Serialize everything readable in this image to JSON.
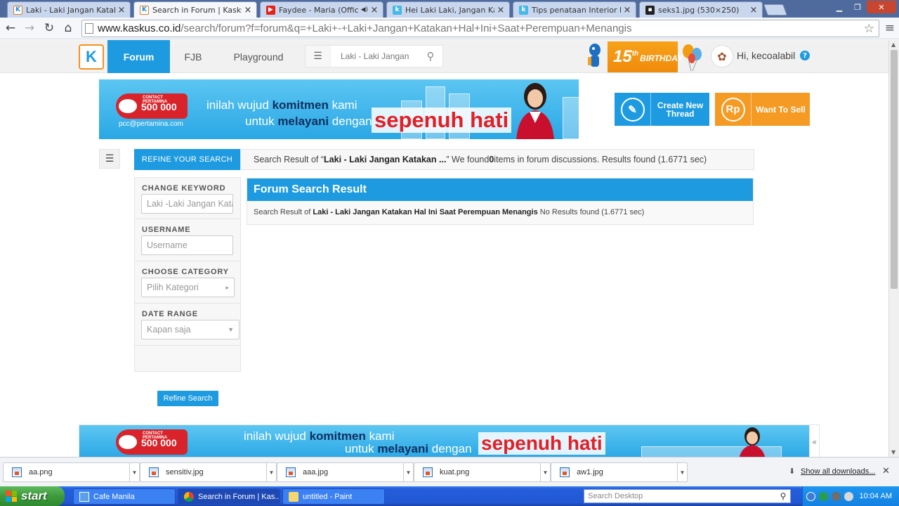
{
  "browser": {
    "tabs": [
      {
        "label": "Laki - Laki Jangan Katakan H",
        "favicon": "kaskus-icon",
        "active": false
      },
      {
        "label": "Search in Forum | Kaskus - Th",
        "favicon": "kaskus-icon",
        "active": true
      },
      {
        "label": "Faydee - Maria (Official V",
        "favicon": "youtube-icon",
        "active": false,
        "audio": true
      },
      {
        "label": "Hei Laki Laki, Jangan Katakan",
        "favicon": "kaskus-k-icon",
        "active": false
      },
      {
        "label": "Tips penataan Interior Ruang",
        "favicon": "kaskus-k-icon",
        "active": false
      },
      {
        "label": "seks1.jpg (530×250)",
        "favicon": "image-icon",
        "active": false
      }
    ],
    "url_host": "www.kaskus.co.id",
    "url_path": "/search/forum?f=forum&q=+Laki+-+Laki+Jangan+Katakan+Hal+Ini+Saat+Perempuan+Menangis"
  },
  "kaskus": {
    "logo": "K",
    "nav": [
      {
        "label": "Forum",
        "active": true
      },
      {
        "label": "FJB",
        "active": false
      },
      {
        "label": "Playground",
        "active": false
      }
    ],
    "search_value": "Laki - Laki Jangan",
    "birthday_num": "15",
    "birthday_sup": "th",
    "birthday_word": "BIRTHDAY",
    "greeting": "Hi, kecoalabil",
    "help": "?"
  },
  "banner": {
    "contact_title": "CONTACT PERTAMINA",
    "contact_number": "500 000",
    "email": "pcc@pertamina.com",
    "line1_pre": "inilah wujud ",
    "line1_bold": "komitmen",
    "line1_post": " kami",
    "line2_pre": "untuk ",
    "line2_bold": "melayani",
    "line2_post": " dengan",
    "big": "sepenuh hati"
  },
  "actions": {
    "create_thread": "Create New Thread",
    "want_to_sell": "Want To Sell",
    "rp_symbol": "Rp"
  },
  "refine": {
    "tab_label": "REFINE YOUR SEARCH",
    "summary_pre": "Search Result of “",
    "summary_query": "Laki - Laki Jangan Katakan ...",
    "summary_mid": "” We found ",
    "summary_count": "0",
    "summary_post": " items in forum discussions. Results found (1.6771 sec)",
    "change_keyword_label": "CHANGE KEYWORD",
    "keyword_value": "Laki -Laki Jangan Kata",
    "username_label": "USERNAME",
    "username_placeholder": "Username",
    "category_label": "CHOOSE CATEGORY",
    "category_value": "Pilih Kategori",
    "date_label": "DATE RANGE",
    "date_value": "Kapan saja",
    "button": "Refine Search"
  },
  "results": {
    "title": "Forum Search Result",
    "body_pre": "Search Result of ",
    "body_query": "Laki - Laki Jangan Katakan Hal Ini Saat Perempuan Menangis",
    "body_post": " No Results found (1.6771 sec)"
  },
  "downloads": {
    "items": [
      "aa.png",
      "sensitiv.jpg",
      "aaa.jpg",
      "kuat.png",
      "aw1.jpg"
    ],
    "show_all": "Show all downloads..."
  },
  "taskbar": {
    "start": "start",
    "tasks": [
      {
        "label": "Cafe Manila",
        "active": false
      },
      {
        "label": "Search in Forum | Kas...",
        "active": true
      },
      {
        "label": "untitled - Paint",
        "active": false
      }
    ],
    "desk_search": "Search Desktop",
    "clock": "10:04 AM"
  }
}
